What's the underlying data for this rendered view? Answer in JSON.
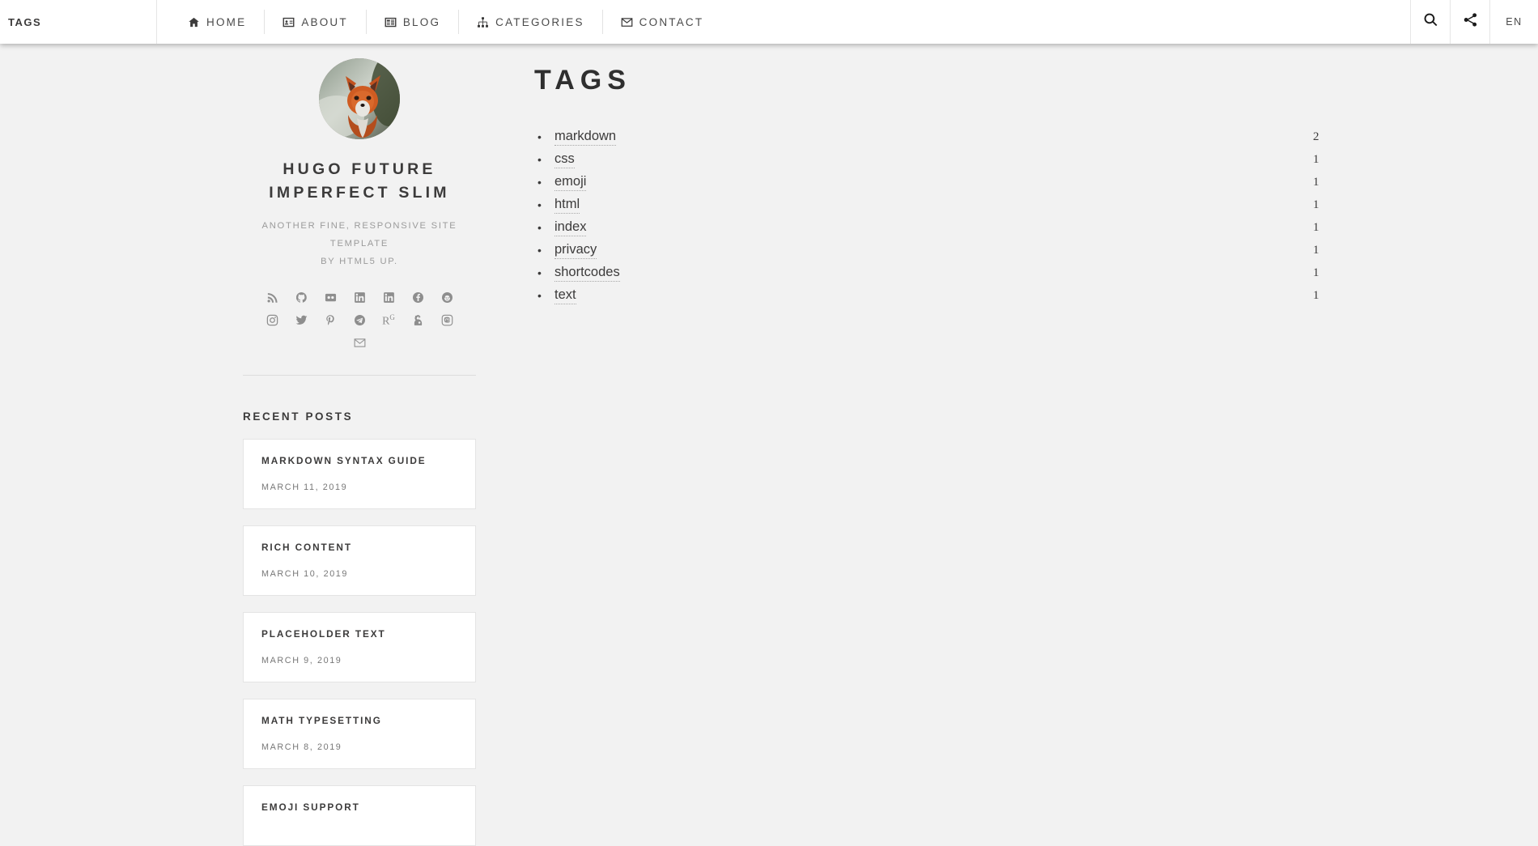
{
  "header": {
    "logo": "TAGS",
    "nav": [
      {
        "label": "HOME",
        "icon": "home-icon"
      },
      {
        "label": "ABOUT",
        "icon": "id-card-icon"
      },
      {
        "label": "BLOG",
        "icon": "blog-list-icon"
      },
      {
        "label": "CATEGORIES",
        "icon": "sitemap-icon"
      },
      {
        "label": "CONTACT",
        "icon": "envelope-icon"
      }
    ],
    "search_icon": "search-icon",
    "share_icon": "share-icon",
    "language": "EN"
  },
  "sidebar": {
    "avatar_alt": "fox-avatar",
    "title": "HUGO FUTURE IMPERFECT SLIM",
    "subtitle_line1": "ANOTHER FINE, RESPONSIVE SITE TEMPLATE",
    "subtitle_line2": "BY HTML5 UP.",
    "social": [
      {
        "name": "rss-icon"
      },
      {
        "name": "github-icon"
      },
      {
        "name": "flickr-icon"
      },
      {
        "name": "linkedin-icon"
      },
      {
        "name": "linkedin-alt-icon"
      },
      {
        "name": "facebook-icon"
      },
      {
        "name": "reddit-icon"
      },
      {
        "name": "instagram-icon"
      },
      {
        "name": "twitter-icon"
      },
      {
        "name": "pinterest-icon"
      },
      {
        "name": "telegram-icon"
      },
      {
        "name": "researchgate-icon"
      },
      {
        "name": "keybase-icon"
      },
      {
        "name": "mastodon-icon"
      },
      {
        "name": "email-icon"
      }
    ],
    "recent_posts_heading": "RECENT POSTS",
    "recent_posts": [
      {
        "title": "MARKDOWN SYNTAX GUIDE",
        "date": "MARCH 11, 2019"
      },
      {
        "title": "RICH CONTENT",
        "date": "MARCH 10, 2019"
      },
      {
        "title": "PLACEHOLDER TEXT",
        "date": "MARCH 9, 2019"
      },
      {
        "title": "MATH TYPESETTING",
        "date": "MARCH 8, 2019"
      },
      {
        "title": "EMOJI SUPPORT",
        "date": ""
      }
    ]
  },
  "main": {
    "title": "TAGS",
    "tags": [
      {
        "label": "markdown",
        "count": "2"
      },
      {
        "label": "css",
        "count": "1"
      },
      {
        "label": "emoji",
        "count": "1"
      },
      {
        "label": "html",
        "count": "1"
      },
      {
        "label": "index",
        "count": "1"
      },
      {
        "label": "privacy",
        "count": "1"
      },
      {
        "label": "shortcodes",
        "count": "1"
      },
      {
        "label": "text",
        "count": "1"
      }
    ]
  },
  "colors": {
    "page_background": "#f2f2f2",
    "header_background": "#ffffff",
    "text_primary": "#3c3b3b",
    "text_muted": "#9b9b9b",
    "card_border": "#e4e4e4"
  }
}
